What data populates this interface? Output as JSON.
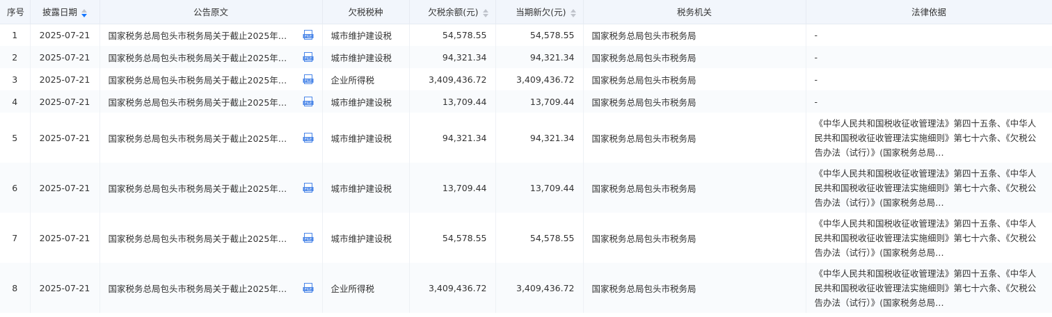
{
  "headers": {
    "index": "序号",
    "date": "披露日期",
    "notice": "公告原文",
    "tax_type": "欠税税种",
    "balance": "欠税余额(元)",
    "new_arrears": "当期新欠(元)",
    "authority": "税务机关",
    "legal_basis": "法律依据"
  },
  "icons": {
    "file": "file-icon",
    "sort_active": "sort-desc-active",
    "sort": "sort-icon"
  },
  "colors": {
    "header_bg": "#f2f6fc",
    "sort_active": "#1677ff",
    "file_icon": "#4a86e8"
  },
  "rows": [
    {
      "index": "1",
      "date": "2025-07-21",
      "notice": "国家税务总局包头市税务局关于截止2025年…",
      "tax_type": "城市维护建设税",
      "balance": "54,578.55",
      "new_arrears": "54,578.55",
      "authority": "国家税务总局包头市税务局",
      "legal_basis": "-"
    },
    {
      "index": "2",
      "date": "2025-07-21",
      "notice": "国家税务总局包头市税务局关于截止2025年…",
      "tax_type": "城市维护建设税",
      "balance": "94,321.34",
      "new_arrears": "94,321.34",
      "authority": "国家税务总局包头市税务局",
      "legal_basis": "-"
    },
    {
      "index": "3",
      "date": "2025-07-21",
      "notice": "国家税务总局包头市税务局关于截止2025年…",
      "tax_type": "企业所得税",
      "balance": "3,409,436.72",
      "new_arrears": "3,409,436.72",
      "authority": "国家税务总局包头市税务局",
      "legal_basis": "-"
    },
    {
      "index": "4",
      "date": "2025-07-21",
      "notice": "国家税务总局包头市税务局关于截止2025年…",
      "tax_type": "城市维护建设税",
      "balance": "13,709.44",
      "new_arrears": "13,709.44",
      "authority": "国家税务总局包头市税务局",
      "legal_basis": "-"
    },
    {
      "index": "5",
      "date": "2025-07-21",
      "notice": "国家税务总局包头市税务局关于截止2025年…",
      "tax_type": "城市维护建设税",
      "balance": "94,321.34",
      "new_arrears": "94,321.34",
      "authority": "国家税务总局包头市税务局",
      "legal_basis": "《中华人民共和国税收征收管理法》第四十五条、《中华人民共和国税收征收管理法实施细则》第七十六条、《欠税公告办法（试行）》(国家税务总局…"
    },
    {
      "index": "6",
      "date": "2025-07-21",
      "notice": "国家税务总局包头市税务局关于截止2025年…",
      "tax_type": "城市维护建设税",
      "balance": "13,709.44",
      "new_arrears": "13,709.44",
      "authority": "国家税务总局包头市税务局",
      "legal_basis": "《中华人民共和国税收征收管理法》第四十五条、《中华人民共和国税收征收管理法实施细则》第七十六条、《欠税公告办法（试行）》(国家税务总局…"
    },
    {
      "index": "7",
      "date": "2025-07-21",
      "notice": "国家税务总局包头市税务局关于截止2025年…",
      "tax_type": "城市维护建设税",
      "balance": "54,578.55",
      "new_arrears": "54,578.55",
      "authority": "国家税务总局包头市税务局",
      "legal_basis": "《中华人民共和国税收征收管理法》第四十五条、《中华人民共和国税收征收管理法实施细则》第七十六条、《欠税公告办法（试行）》(国家税务总局…"
    },
    {
      "index": "8",
      "date": "2025-07-21",
      "notice": "国家税务总局包头市税务局关于截止2025年…",
      "tax_type": "企业所得税",
      "balance": "3,409,436.72",
      "new_arrears": "3,409,436.72",
      "authority": "国家税务总局包头市税务局",
      "legal_basis": "《中华人民共和国税收征收管理法》第四十五条、《中华人民共和国税收征收管理法实施细则》第七十六条、《欠税公告办法（试行）》(国家税务总局…"
    }
  ]
}
